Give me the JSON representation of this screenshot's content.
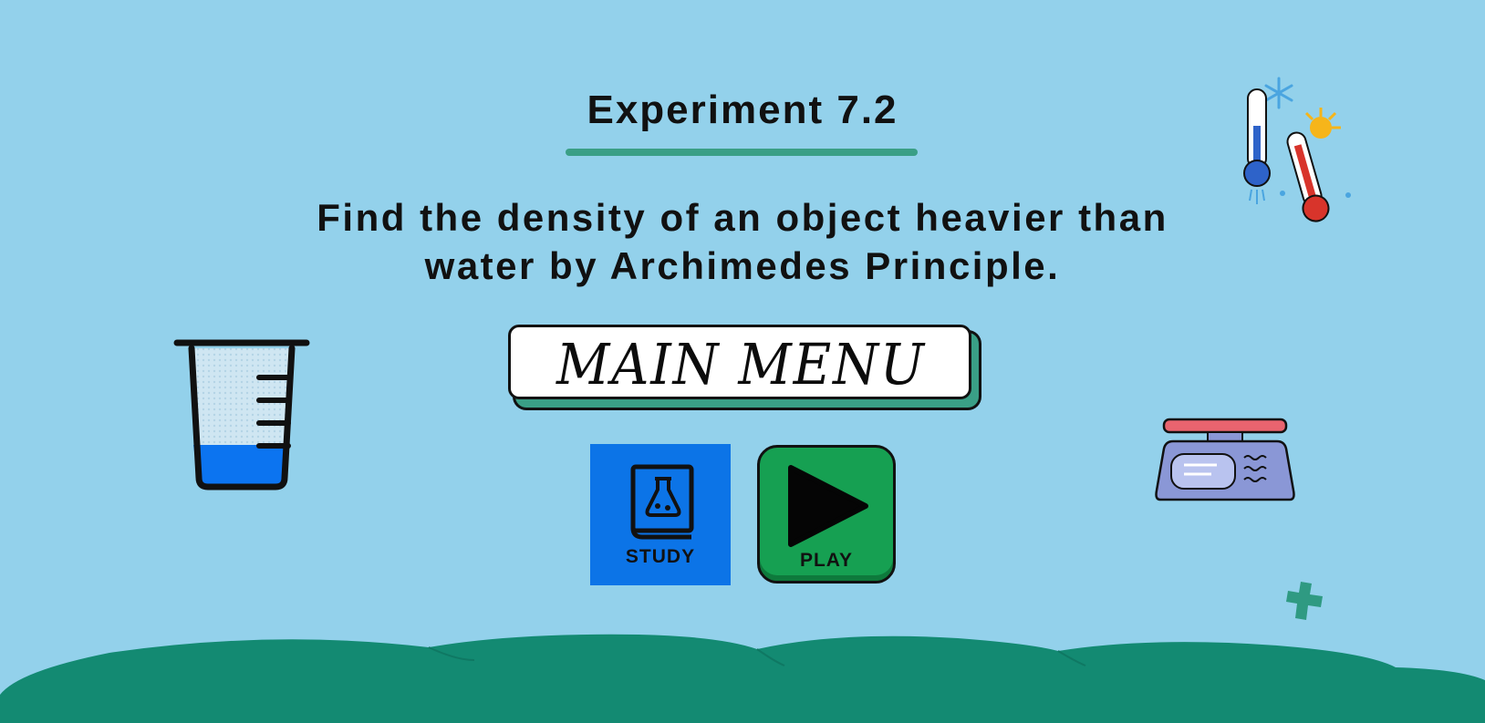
{
  "header": {
    "title": "Experiment 7.2",
    "subtitle_line1": "Find the density of an object heavier than",
    "subtitle_line2": "water by Archimedes Principle."
  },
  "menu": {
    "main_menu_label": "MAIN MENU"
  },
  "buttons": {
    "study": {
      "label": "STUDY",
      "icon": "flask-book-icon",
      "color": "#0c74e7"
    },
    "play": {
      "label": "PLAY",
      "icon": "play-icon",
      "color": "#16a052"
    }
  },
  "decorations": {
    "beaker": "beaker-icon",
    "thermometers": "thermometers-icon",
    "scale": "weighing-scale-icon",
    "plus": "plus-icon"
  },
  "colors": {
    "background": "#93d1eb",
    "accent": "#3a9f86",
    "hills": "#138a72"
  }
}
